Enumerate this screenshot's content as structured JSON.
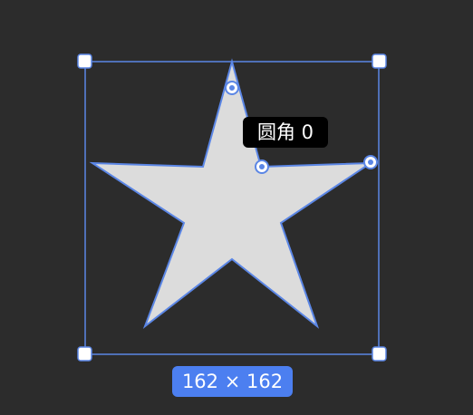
{
  "canvas": {
    "background": "#2c2c2c"
  },
  "selection": {
    "accent": "#5b86e5",
    "handle_icon": "square-resize-handle-icon"
  },
  "shape": {
    "kind": "star",
    "points_count": 5,
    "fill": "#dcdcdc",
    "stroke": "#5b86e5"
  },
  "tooltip": {
    "label": "圆角 0",
    "corner_radius_value": 0
  },
  "size_badge": {
    "label": "162 × 162",
    "width": 162,
    "height": 162,
    "background": "#4c7ff0"
  }
}
